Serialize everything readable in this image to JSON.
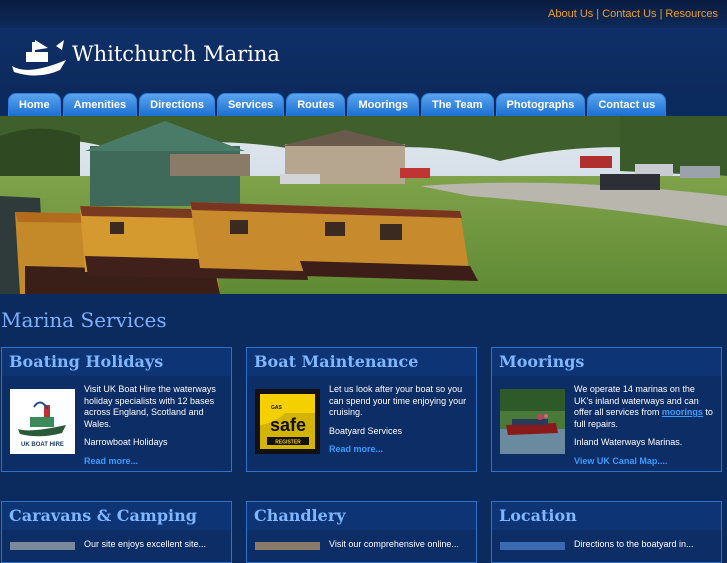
{
  "top_links": [
    "About Us",
    "Contact Us",
    "Resources"
  ],
  "site_title": "Whitchurch Marina",
  "nav": [
    "Home",
    "Amenities",
    "Directions",
    "Services",
    "Routes",
    "Moorings",
    "The Team",
    "Photographs",
    "Contact us"
  ],
  "page_heading": "Marina Services",
  "cards": [
    {
      "title": "Boating Holidays",
      "thumb_caption": "UK BOAT HIRE",
      "body": "Visit UK Boat Hire the waterways holiday specialists with 12 bases across England, Scotland and Wales.",
      "sub": "Narrowboat Holidays",
      "more": "Read more..."
    },
    {
      "title": "Boat Maintenance",
      "thumb_caption_top": "GAS",
      "thumb_caption": "safe",
      "thumb_caption_bottom": "REGISTER",
      "body": "Let us look after your boat so you can spend your time enjoying your cruising.",
      "sub": "Boatyard Services",
      "more": "Read more..."
    },
    {
      "title": "Moorings",
      "body_pre": "We operate 14 marinas on the UK's inland waterways and can offer all services from",
      "body_link": "moorings",
      "body_post": "to full repairs.",
      "sub": "Inland Waterways Marinas.",
      "more": "View UK Canal Map...."
    },
    {
      "title": "Caravans & Camping",
      "body": "Our site enjoys excellent site..."
    },
    {
      "title": "Chandlery",
      "body": "Visit our comprehensive online..."
    },
    {
      "title": "Location",
      "body": "Directions to the boatyard in..."
    }
  ],
  "colors": {
    "accent": "#f0a020",
    "link": "#3b9dff",
    "heading": "#7fb0ff",
    "bg": "#0b2a5e"
  }
}
